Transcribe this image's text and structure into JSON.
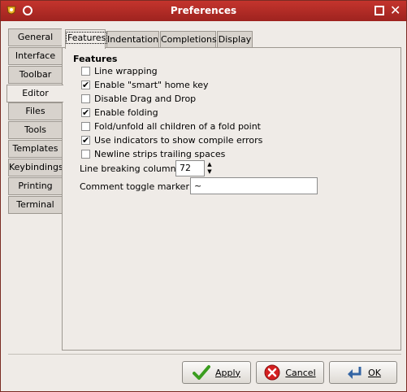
{
  "window": {
    "title": "Preferences"
  },
  "sidebar": {
    "tabs": [
      {
        "label": "General",
        "active": false
      },
      {
        "label": "Interface",
        "active": false
      },
      {
        "label": "Toolbar",
        "active": false
      },
      {
        "label": "Editor",
        "active": true
      },
      {
        "label": "Files",
        "active": false
      },
      {
        "label": "Tools",
        "active": false
      },
      {
        "label": "Templates",
        "active": false
      },
      {
        "label": "Keybindings",
        "active": false
      },
      {
        "label": "Printing",
        "active": false
      },
      {
        "label": "Terminal",
        "active": false
      }
    ]
  },
  "editor_tabs": [
    {
      "label": "Features",
      "active": true
    },
    {
      "label": "Indentation",
      "active": false
    },
    {
      "label": "Completions",
      "active": false
    },
    {
      "label": "Display",
      "active": false
    }
  ],
  "features": {
    "heading": "Features",
    "options": [
      {
        "label": "Line wrapping",
        "checked": false
      },
      {
        "label": "Enable \"smart\" home key",
        "checked": true
      },
      {
        "label": "Disable Drag and Drop",
        "checked": false
      },
      {
        "label": "Enable folding",
        "checked": true
      },
      {
        "label": "Fold/unfold all children of a fold point",
        "checked": false
      },
      {
        "label": "Use indicators to show compile errors",
        "checked": true
      },
      {
        "label": "Newline strips trailing spaces",
        "checked": false
      }
    ],
    "line_breaking_label": "Line breaking column:",
    "line_breaking_value": "72",
    "comment_toggle_label": "Comment toggle marker:",
    "comment_toggle_value": "~"
  },
  "buttons": {
    "apply": "Apply",
    "cancel": "Cancel",
    "ok": "OK"
  },
  "colors": {
    "titlebar": "#b52b26",
    "check_mark": "#000000",
    "apply_icon": "#3a9d1f",
    "cancel_icon": "#d42020",
    "ok_icon": "#3465a4"
  }
}
